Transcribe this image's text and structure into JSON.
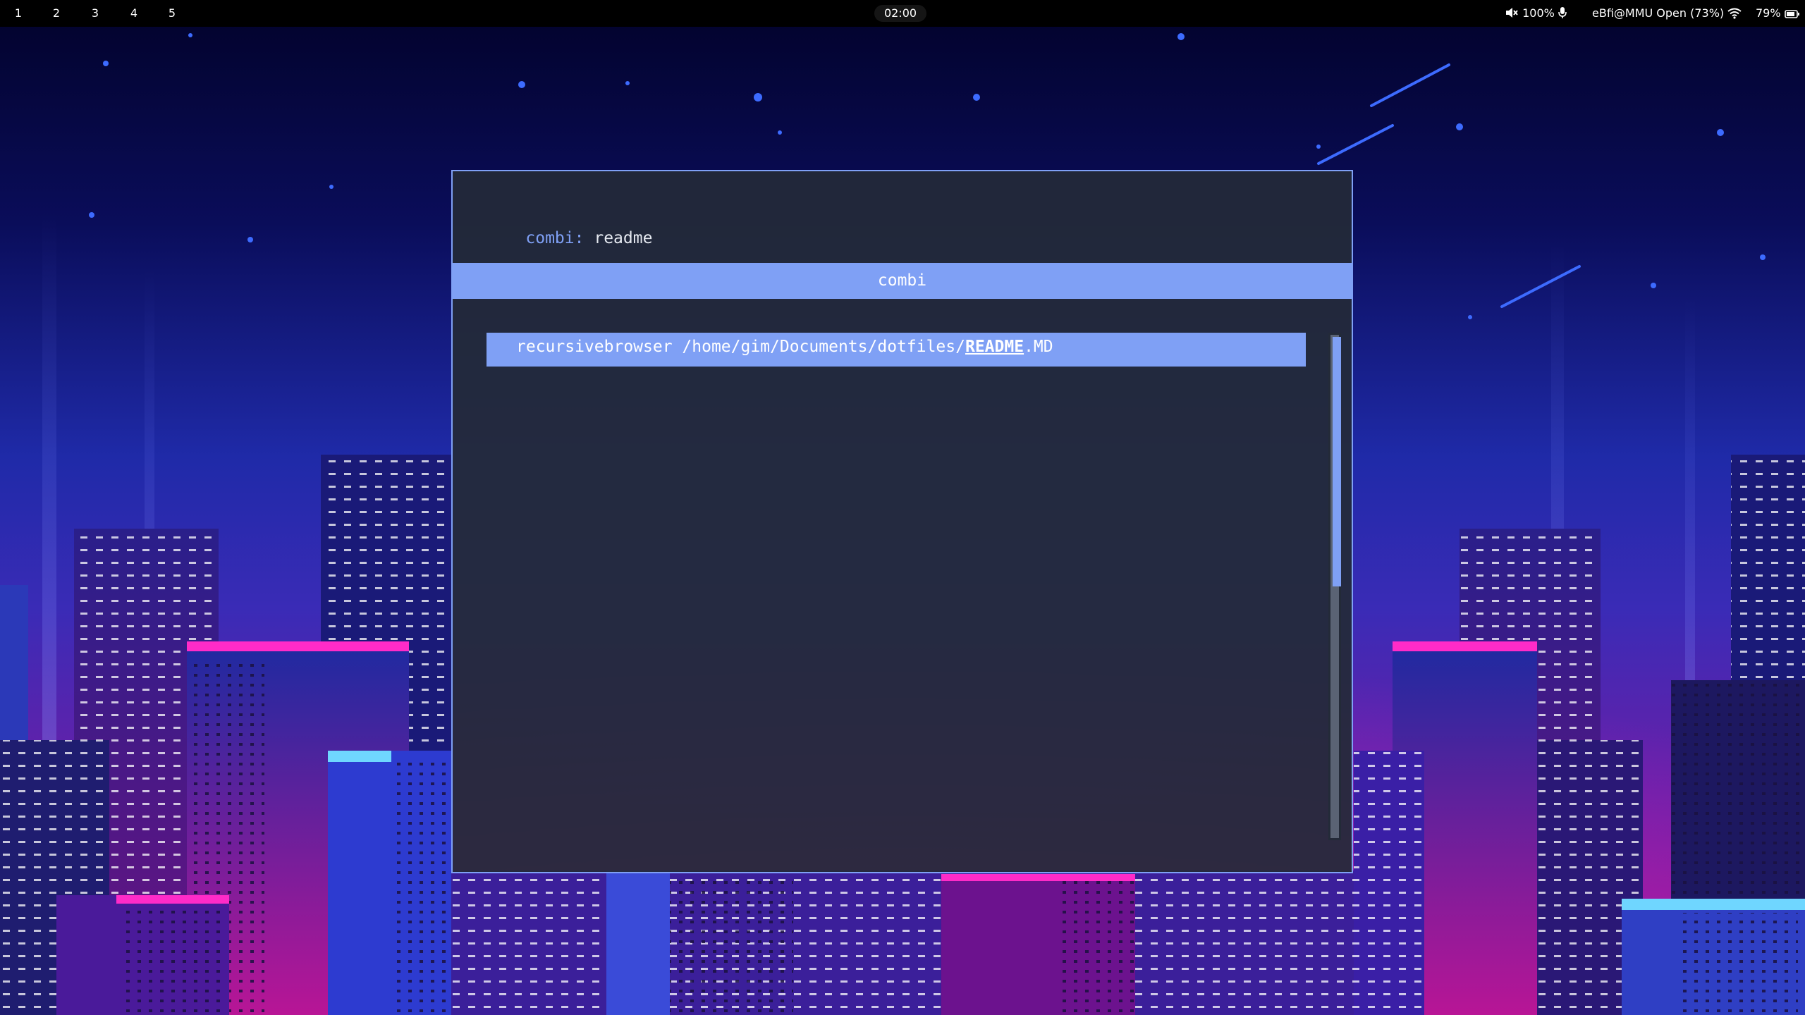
{
  "topbar": {
    "workspaces": [
      "1",
      "2",
      "3",
      "4",
      "5"
    ],
    "clock": "02:00",
    "volume": "100%",
    "network": "eBfi@MMU Open (73%)",
    "battery": "79%",
    "icons": {
      "volume": "speaker-muted-icon",
      "mic": "microphone-icon",
      "wifi": "wifi-icon",
      "battery": "battery-icon"
    }
  },
  "launcher": {
    "prompt_label": "combi",
    "prompt_sep": ":",
    "input_value": "readme",
    "mode": "combi",
    "results": [
      {
        "prefix": "recursivebrowser /home/gim/Documents/dotfiles/",
        "match": "README",
        "suffix": ".MD",
        "selected": true
      }
    ],
    "scroll_fraction": 0.5
  },
  "colors": {
    "accent": "#7fa0f5",
    "window_bg": "#232a38",
    "text": "#e5e9f0"
  }
}
